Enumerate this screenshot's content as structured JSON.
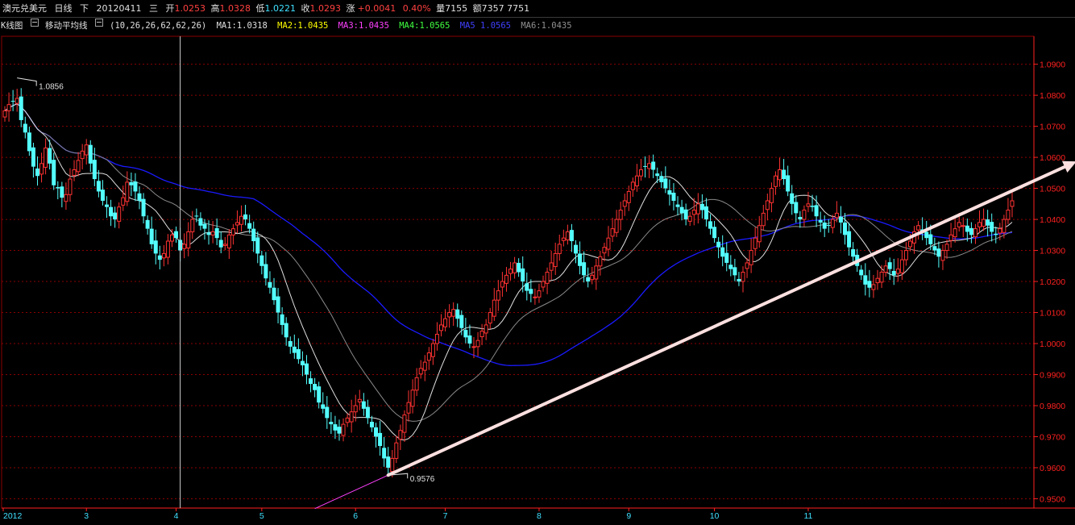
{
  "header": {
    "instrument": "澳元兑美元",
    "period": "日线",
    "direction": "下",
    "date": "20120411",
    "weekday": "三",
    "open_label": "开",
    "open": "1.0253",
    "high_label": "高",
    "high": "1.0328",
    "low_label": "低",
    "low": "1.0221",
    "close_label": "收",
    "close": "1.0293",
    "change_label": "涨",
    "change": "+0.0041",
    "change_pct": "0.40%",
    "volume_label": "量",
    "volume": "7155",
    "amount_label": "额",
    "amount": "7357 7751"
  },
  "indicator": {
    "chart_label": "K线图",
    "name": "移动平均线",
    "params": "(10,26,26,62,62,26)",
    "ma": [
      {
        "label": "MA1:1.0318",
        "color": "#e0e0e0"
      },
      {
        "label": "MA2:1.0435",
        "color": "#ffff00"
      },
      {
        "label": "MA3:1.0435",
        "color": "#ff40ff"
      },
      {
        "label": "MA4:1.0565",
        "color": "#40ff40"
      },
      {
        "label": "MA5 1.0565",
        "color": "#4040ff"
      },
      {
        "label": "MA6:1.0435",
        "color": "#909090"
      }
    ]
  },
  "colors": {
    "up": "#ff3232",
    "down": "#54ffff",
    "grid": "#8b0000",
    "axis": "#ff2020",
    "ma_short": "#e0e0e0",
    "ma_long": "#1a1aff",
    "ma_mid": "#8a8a8a",
    "trend": "#ffe0e0",
    "trend_ext": "#ff40ff"
  },
  "chart_data": {
    "type": "candlestick",
    "y_axis_ticks": [
      "1.0900",
      "1.0800",
      "1.0700",
      "1.0600",
      "1.0500",
      "1.0400",
      "1.0300",
      "1.0200",
      "1.0100",
      "1.0000",
      "0.9900",
      "0.9800",
      "0.9700",
      "0.9600",
      "0.9500"
    ],
    "ylim": [
      0.947,
      1.099
    ],
    "x_axis_labels": [
      {
        "label": "2012",
        "index": 0
      },
      {
        "label": "3",
        "index": 20
      },
      {
        "label": "4",
        "index": 42
      },
      {
        "label": "5",
        "index": 63
      },
      {
        "label": "6",
        "index": 86
      },
      {
        "label": "7",
        "index": 108
      },
      {
        "label": "8",
        "index": 131
      },
      {
        "label": "9",
        "index": 153
      },
      {
        "label": "10",
        "index": 174
      },
      {
        "label": "11",
        "index": 197
      }
    ],
    "marked_high": {
      "label": "1.0856",
      "index": 3,
      "value": 1.0856
    },
    "marked_low": {
      "label": "0.9576",
      "index": 94,
      "value": 0.9576
    },
    "cursor_index": 43,
    "trendline": {
      "from": {
        "index": 94,
        "value": 0.9576
      },
      "to": {
        "index": 265,
        "value": 1.06
      }
    },
    "closes": [
      1.075,
      1.077,
      1.078,
      1.079,
      1.072,
      1.068,
      1.062,
      1.057,
      1.054,
      1.058,
      1.063,
      1.058,
      1.051,
      1.05,
      1.047,
      1.048,
      1.053,
      1.056,
      1.059,
      1.062,
      1.064,
      1.058,
      1.053,
      1.049,
      1.046,
      1.044,
      1.041,
      1.04,
      1.044,
      1.047,
      1.052,
      1.051,
      1.049,
      1.046,
      1.041,
      1.037,
      1.032,
      1.029,
      1.027,
      1.029,
      1.033,
      1.035,
      1.034,
      1.03,
      1.032,
      1.036,
      1.04,
      1.041,
      1.038,
      1.037,
      1.035,
      1.036,
      1.034,
      1.031,
      1.032,
      1.035,
      1.037,
      1.039,
      1.041,
      1.04,
      1.037,
      1.033,
      1.029,
      1.025,
      1.021,
      1.018,
      1.014,
      1.01,
      1.006,
      1.002,
      0.999,
      0.997,
      0.995,
      0.993,
      0.99,
      0.987,
      0.985,
      0.981,
      0.979,
      0.976,
      0.974,
      0.972,
      0.971,
      0.974,
      0.976,
      0.978,
      0.98,
      0.982,
      0.979,
      0.976,
      0.973,
      0.97,
      0.967,
      0.963,
      0.96,
      0.963,
      0.968,
      0.972,
      0.977,
      0.981,
      0.985,
      0.989,
      0.992,
      0.994,
      0.997,
      1.0,
      1.003,
      1.006,
      1.008,
      1.01,
      1.011,
      1.008,
      1.005,
      1.002,
      1.0,
      0.999,
      1.001,
      1.004,
      1.006,
      1.01,
      1.014,
      1.017,
      1.02,
      1.022,
      1.024,
      1.026,
      1.023,
      1.02,
      1.017,
      1.016,
      1.015,
      1.017,
      1.02,
      1.023,
      1.026,
      1.029,
      1.032,
      1.034,
      1.036,
      1.033,
      1.029,
      1.025,
      1.022,
      1.02,
      1.022,
      1.025,
      1.028,
      1.031,
      1.034,
      1.037,
      1.04,
      1.043,
      1.046,
      1.049,
      1.052,
      1.054,
      1.056,
      1.057,
      1.058,
      1.056,
      1.054,
      1.052,
      1.05,
      1.048,
      1.046,
      1.044,
      1.042,
      1.04,
      1.041,
      1.043,
      1.045,
      1.043,
      1.04,
      1.037,
      1.034,
      1.031,
      1.028,
      1.026,
      1.024,
      1.022,
      1.02,
      1.023,
      1.026,
      1.03,
      1.034,
      1.038,
      1.042,
      1.046,
      1.05,
      1.054,
      1.056,
      1.053,
      1.049,
      1.045,
      1.042,
      1.04,
      1.043,
      1.045,
      1.044,
      1.041,
      1.039,
      1.037,
      1.038,
      1.04,
      1.042,
      1.039,
      1.035,
      1.031,
      1.028,
      1.025,
      1.022,
      1.019,
      1.018,
      1.019,
      1.021,
      1.023,
      1.025,
      1.024,
      1.022,
      1.024,
      1.027,
      1.03,
      1.033,
      1.036,
      1.038,
      1.036,
      1.034,
      1.032,
      1.03,
      1.028,
      1.03,
      1.032,
      1.035,
      1.037,
      1.039,
      1.038,
      1.036,
      1.035,
      1.037,
      1.039,
      1.04,
      1.038,
      1.036,
      1.035,
      1.037,
      1.04,
      1.043,
      1.046
    ]
  }
}
